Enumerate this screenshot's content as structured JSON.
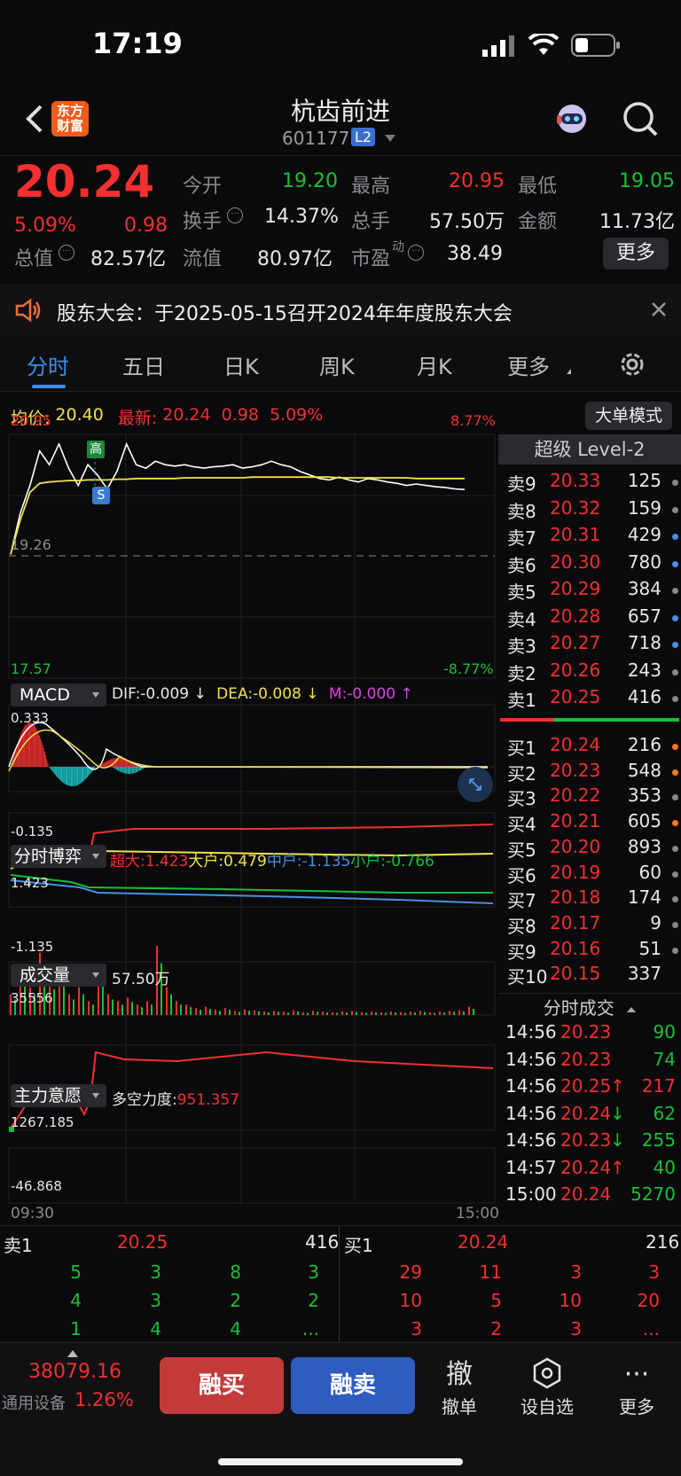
{
  "status": {
    "time": "17:19"
  },
  "header": {
    "title": "杭齿前进",
    "code": "601177",
    "level_badge": "L2",
    "logo_text": "东方\n财富"
  },
  "quote": {
    "price": "20.24",
    "change_pct": "5.09%",
    "change": "0.98",
    "open_label": "今开",
    "open": "19.20",
    "high_label": "最高",
    "high": "20.95",
    "low_label": "最低",
    "low": "19.05",
    "turnover_label": "换手",
    "turnover": "14.37%",
    "volume_label": "总手",
    "volume": "57.50万",
    "amount_label": "金额",
    "amount": "11.73亿",
    "mktcap_label": "总值",
    "mktcap": "82.57亿",
    "float_label": "流值",
    "float": "80.97亿",
    "pe_label": "市盈",
    "pe_sup": "动",
    "pe": "38.49",
    "more_label": "更多"
  },
  "notice": {
    "text": "股东大会：于2025-05-15召开2024年年度股东大会"
  },
  "tabs": [
    "分时",
    "五日",
    "日K",
    "周K",
    "月K",
    "更多"
  ],
  "chart_top": {
    "avg_label": "均价:",
    "avg": "20.40",
    "latest_label": "最新:",
    "latest": "20.24",
    "latest_chg": "0.98",
    "latest_pct": "5.09%",
    "mode_btn": "大单模式"
  },
  "chart_data": {
    "type": "line",
    "x_start": "09:30",
    "x_end": "15:00",
    "price_high": "20.95",
    "price_mid": "19.26",
    "price_low": "17.57",
    "pct_high": "8.77%",
    "pct_low": "-8.77%",
    "marker_high": "高",
    "marker_s": "S",
    "price_series": [
      19.3,
      19.9,
      20.3,
      20.8,
      20.6,
      20.9,
      20.55,
      20.3,
      20.6,
      20.45,
      20.25,
      20.5,
      20.9,
      20.6,
      20.55,
      20.65,
      20.6,
      20.58,
      20.6,
      20.57,
      20.55,
      20.57,
      20.58,
      20.6,
      20.55,
      20.57,
      20.6,
      20.65,
      20.6,
      20.57,
      20.5,
      20.45,
      20.4,
      20.38,
      20.42,
      20.38,
      20.35,
      20.4,
      20.38,
      20.35,
      20.33,
      20.3,
      20.32,
      20.3,
      20.28,
      20.27,
      20.25,
      20.24
    ],
    "avg_series": [
      19.3,
      19.8,
      20.2,
      20.33,
      20.35,
      20.36,
      20.37,
      20.37,
      20.38,
      20.38,
      20.38,
      20.39,
      20.39,
      20.4,
      20.4,
      20.4,
      20.4,
      20.4,
      20.41,
      20.41,
      20.41,
      20.41,
      20.41,
      20.41,
      20.41,
      20.42,
      20.42,
      20.42,
      20.42,
      20.42,
      20.42,
      20.42,
      20.42,
      20.42,
      20.41,
      20.41,
      20.41,
      20.41,
      20.41,
      20.41,
      20.41,
      20.41,
      20.4,
      20.4,
      20.4,
      20.4,
      20.4,
      20.4
    ],
    "macd": {
      "label": "MACD",
      "dif": "DIF:-0.009 ↓",
      "dea": "DEA:-0.008 ↓",
      "m": "M:-0.000 ↑",
      "top": "0.333",
      "bottom": "-0.135"
    },
    "bop": {
      "label": "分时博弈",
      "super": "超大:1.423",
      "big": "大户:0.479",
      "mid": "中户:-1.135",
      "small": "小户:-0.766",
      "top": "1.423",
      "bottom": "-1.135"
    },
    "volume": {
      "label": "成交量",
      "total": "57.50万",
      "top": "35556",
      "bars": [
        0.3,
        0.6,
        0.4,
        0.9,
        0.5,
        0.7,
        0.3,
        0.4,
        0.2,
        0.6,
        0.3,
        0.2,
        0.25,
        0.15,
        0.2,
        1.0,
        0.4,
        0.2,
        0.15,
        0.1,
        0.12,
        0.08,
        0.1,
        0.06,
        0.08,
        0.07,
        0.05,
        0.06,
        0.05,
        0.07,
        0.04,
        0.06,
        0.05,
        0.04,
        0.05,
        0.06,
        0.04,
        0.05,
        0.04,
        0.05,
        0.04,
        0.05,
        0.06,
        0.04,
        0.05,
        0.06,
        0.07,
        0.12
      ]
    },
    "intent": {
      "label": "主力意愿",
      "strength_label": "多空力度:",
      "strength": "951.357",
      "top": "1267.185",
      "bottom": "-46.868"
    }
  },
  "book": {
    "title": "超级 Level-2",
    "asks": [
      {
        "label": "卖9",
        "price": "20.33",
        "vol": "125",
        "dot": "#888"
      },
      {
        "label": "卖8",
        "price": "20.32",
        "vol": "159",
        "dot": "#888"
      },
      {
        "label": "卖7",
        "price": "20.31",
        "vol": "429",
        "dot": "#4a8fe6"
      },
      {
        "label": "卖6",
        "price": "20.30",
        "vol": "780",
        "dot": "#4a8fe6"
      },
      {
        "label": "卖5",
        "price": "20.29",
        "vol": "384",
        "dot": "#888"
      },
      {
        "label": "卖4",
        "price": "20.28",
        "vol": "657",
        "dot": "#4a8fe6"
      },
      {
        "label": "卖3",
        "price": "20.27",
        "vol": "718",
        "dot": "#4a8fe6"
      },
      {
        "label": "卖2",
        "price": "20.26",
        "vol": "243",
        "dot": "#888"
      },
      {
        "label": "卖1",
        "price": "20.25",
        "vol": "416",
        "dot": "#888"
      }
    ],
    "bids": [
      {
        "label": "买1",
        "price": "20.24",
        "vol": "216",
        "dot": "#ff7a1a"
      },
      {
        "label": "买2",
        "price": "20.23",
        "vol": "548",
        "dot": "#ff7a1a"
      },
      {
        "label": "买3",
        "price": "20.22",
        "vol": "353",
        "dot": "#888"
      },
      {
        "label": "买4",
        "price": "20.21",
        "vol": "605",
        "dot": "#ff7a1a"
      },
      {
        "label": "买5",
        "price": "20.20",
        "vol": "893",
        "dot": "#888"
      },
      {
        "label": "买6",
        "price": "20.19",
        "vol": "60",
        "dot": "#888"
      },
      {
        "label": "买7",
        "price": "20.18",
        "vol": "174",
        "dot": "#888"
      },
      {
        "label": "买8",
        "price": "20.17",
        "vol": "9",
        "dot": "#888"
      },
      {
        "label": "买9",
        "price": "20.16",
        "vol": "51",
        "dot": "#888"
      },
      {
        "label": "买10",
        "price": "20.15",
        "vol": "337",
        "dot": ""
      }
    ],
    "trades_title": "分时成交",
    "trades": [
      {
        "time": "14:56",
        "price": "20.23",
        "arrow": "",
        "vol": "90",
        "color": "g"
      },
      {
        "time": "14:56",
        "price": "20.23",
        "arrow": "",
        "vol": "74",
        "color": "g"
      },
      {
        "time": "14:56",
        "price": "20.25",
        "arrow": "↑",
        "vol": "217",
        "color": "r"
      },
      {
        "time": "14:56",
        "price": "20.24",
        "arrow": "↓",
        "vol": "62",
        "color": "g"
      },
      {
        "time": "14:56",
        "price": "20.23",
        "arrow": "↓",
        "vol": "255",
        "color": "g"
      },
      {
        "time": "14:57",
        "price": "20.24",
        "arrow": "↑",
        "vol": "40",
        "color": "g"
      },
      {
        "time": "15:00",
        "price": "20.24",
        "arrow": "",
        "vol": "5270",
        "color": "g"
      }
    ]
  },
  "queue": {
    "ask_label": "卖1",
    "ask_price": "20.25",
    "ask_vol": "416",
    "bid_label": "买1",
    "bid_price": "20.24",
    "bid_vol": "216",
    "ask_rows": [
      [
        "5",
        "3",
        "8",
        "3"
      ],
      [
        "4",
        "3",
        "2",
        "2"
      ],
      [
        "1",
        "4",
        "4",
        "..."
      ]
    ],
    "bid_rows": [
      [
        "29",
        "11",
        "3",
        "3"
      ],
      [
        "10",
        "5",
        "10",
        "20"
      ],
      [
        "3",
        "2",
        "3",
        "..."
      ]
    ]
  },
  "footer": {
    "index_value": "38079.16",
    "index_name": "通用设备",
    "index_pct": "1.26%",
    "margin_buy": "融买",
    "margin_sell": "融卖",
    "cancel_icon": "撤",
    "cancel": "撤单",
    "watch": "设自选",
    "more": "更多"
  }
}
